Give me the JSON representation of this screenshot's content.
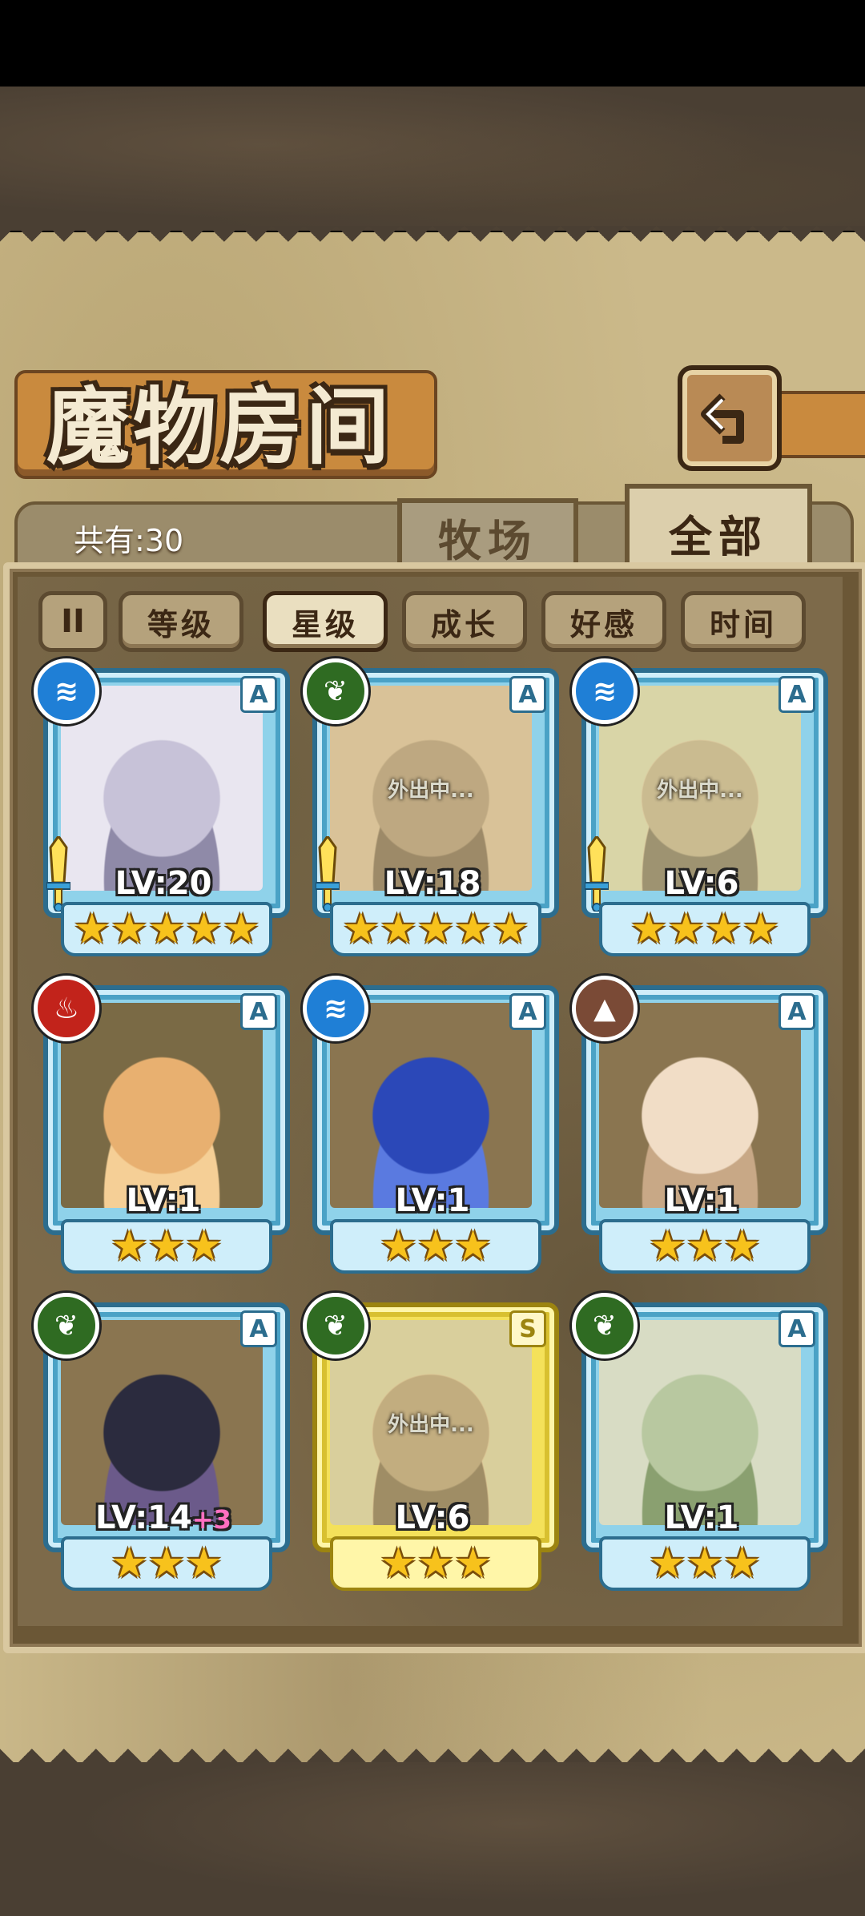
{
  "header": {
    "title": "魔物房间",
    "count_label": "共有:30"
  },
  "tabs": {
    "ranch": "牧场",
    "all": "全部",
    "active": "全部"
  },
  "sort": {
    "pause": "II",
    "options": [
      "等级",
      "星级",
      "成长",
      "好感",
      "时间"
    ],
    "active": "星级"
  },
  "out_label": "外出中...",
  "colors": {
    "frame_blue": "#4aa2c6",
    "frame_gold": "#d8c030",
    "star": "#f7c21c",
    "plus": "#ff6fc0"
  },
  "monsters": [
    {
      "element": "water",
      "element_icon": "water-waves-icon",
      "rank": "A",
      "level": "LV:20",
      "plus": "",
      "stars": "★★★★★",
      "weapon": true,
      "out": false
    },
    {
      "element": "grass",
      "element_icon": "leaf-icon",
      "rank": "A",
      "level": "LV:18",
      "plus": "",
      "stars": "★★★★★",
      "weapon": true,
      "out": true
    },
    {
      "element": "water",
      "element_icon": "water-waves-icon",
      "rank": "A",
      "level": "LV:6",
      "plus": "",
      "stars": "★★★★",
      "weapon": true,
      "out": true
    },
    {
      "element": "fire",
      "element_icon": "flame-icon",
      "rank": "A",
      "level": "LV:1",
      "plus": "",
      "stars": "★★★",
      "weapon": false,
      "out": false
    },
    {
      "element": "water",
      "element_icon": "water-waves-icon",
      "rank": "A",
      "level": "LV:1",
      "plus": "",
      "stars": "★★★",
      "weapon": false,
      "out": false
    },
    {
      "element": "earth",
      "element_icon": "rock-icon",
      "rank": "A",
      "level": "LV:1",
      "plus": "",
      "stars": "★★★",
      "weapon": false,
      "out": false
    },
    {
      "element": "grass",
      "element_icon": "leaf-icon",
      "rank": "A",
      "level": "LV:14",
      "plus": "+3",
      "stars": "★★★",
      "weapon": false,
      "out": false
    },
    {
      "element": "grass",
      "element_icon": "leaf-icon",
      "rank": "S",
      "level": "LV:6",
      "plus": "",
      "stars": "★★★",
      "weapon": false,
      "out": true
    },
    {
      "element": "grass",
      "element_icon": "leaf-icon",
      "rank": "A",
      "level": "LV:1",
      "plus": "",
      "stars": "★★★",
      "weapon": false,
      "out": false
    }
  ]
}
